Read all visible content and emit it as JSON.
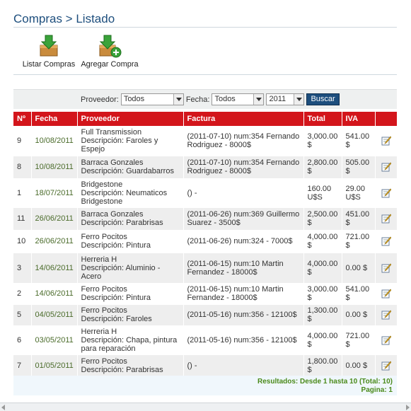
{
  "header": {
    "title": "Compras > Listado"
  },
  "toolbar": {
    "list_label": "Listar Compras",
    "add_label": "Agregar Compra"
  },
  "filters": {
    "proveedor_label": "Proveedor:",
    "proveedor_value": "Todos",
    "fecha_label": "Fecha:",
    "fecha_value": "Todos",
    "year_value": "2011",
    "search_label": "Buscar"
  },
  "table": {
    "columns": [
      "Nº",
      "Fecha",
      "Proveedor",
      "Factura",
      "Total",
      "IVA"
    ],
    "rows": [
      {
        "n": "9",
        "fecha": "10/08/2011",
        "proveedor": "Full Transmission",
        "descripcion": "Descripción: Faroles y Espejo",
        "factura": "(2011-07-10) num:354 Fernando Rodriguez - 8000$",
        "total": "3,000.00 $",
        "iva": "541.00 $"
      },
      {
        "n": "8",
        "fecha": "10/08/2011",
        "proveedor": "Barraca Gonzales",
        "descripcion": "Descripción: Guardabarros",
        "factura": "(2011-07-10) num:354 Fernando Rodriguez - 8000$",
        "total": "2,800.00 $",
        "iva": "505.00 $"
      },
      {
        "n": "1",
        "fecha": "18/07/2011",
        "proveedor": "Bridgestone",
        "descripcion": "Descripción: Neumaticos Bridgestone",
        "factura": "() -",
        "total": "160.00 U$S",
        "iva": "29.00 U$S"
      },
      {
        "n": "11",
        "fecha": "26/06/2011",
        "proveedor": "Barraca Gonzales",
        "descripcion": "Descripción: Parabrisas",
        "factura": "(2011-06-26) num:369 Guillermo Suarez - 3500$",
        "total": "2,500.00 $",
        "iva": "451.00 $"
      },
      {
        "n": "10",
        "fecha": "26/06/2011",
        "proveedor": "Ferro Pocitos",
        "descripcion": "Descripción: Pintura",
        "factura": "(2011-06-26) num:324 - 7000$",
        "total": "4,000.00 $",
        "iva": "721.00 $"
      },
      {
        "n": "3",
        "fecha": "14/06/2011",
        "proveedor": "Herreria H",
        "descripcion": "Descripción: Aluminio - Acero",
        "factura": "(2011-06-15) num:10 Martin Fernandez - 18000$",
        "total": "4,000.00 $",
        "iva": "0.00 $"
      },
      {
        "n": "2",
        "fecha": "14/06/2011",
        "proveedor": "Ferro Pocitos",
        "descripcion": "Descripción: Pintura",
        "factura": "(2011-06-15) num:10 Martin Fernandez - 18000$",
        "total": "3,000.00 $",
        "iva": "541.00 $"
      },
      {
        "n": "5",
        "fecha": "04/05/2011",
        "proveedor": "Ferro Pocitos",
        "descripcion": "Descripción: Faroles",
        "factura": "(2011-05-16) num:356 - 12100$",
        "total": "1,300.00 $",
        "iva": "0.00 $"
      },
      {
        "n": "6",
        "fecha": "03/05/2011",
        "proveedor": "Herreria H",
        "descripcion": "Descripción: Chapa, pintura para reparación",
        "factura": "(2011-05-16) num:356 - 12100$",
        "total": "4,000.00 $",
        "iva": "721.00 $"
      },
      {
        "n": "7",
        "fecha": "01/05/2011",
        "proveedor": "Ferro Pocitos",
        "descripcion": "Descripción: Parabrisas",
        "factura": "() -",
        "total": "1,800.00 $",
        "iva": "0.00 $"
      }
    ]
  },
  "footer": {
    "results": "Resultados: Desde 1 hasta 10 (Total: 10)",
    "page": "Pagina: 1"
  },
  "colors": {
    "title": "#1d4e7d",
    "header_bg": "#d3151b",
    "date_text": "#4a6b2a",
    "footer_text": "#4a8a1a"
  }
}
